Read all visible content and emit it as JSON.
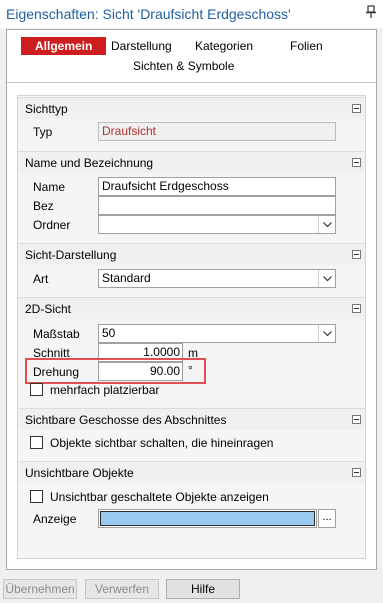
{
  "window": {
    "title": "Eigenschaften: Sicht 'Draufsicht Erdgeschoss'",
    "pin_icon": "pin-icon"
  },
  "tabs": [
    {
      "label": "Allgemein",
      "active": true
    },
    {
      "label": "Darstellung",
      "active": false
    },
    {
      "label": "Kategorien",
      "active": false
    },
    {
      "label": "Folien",
      "active": false
    },
    {
      "label": "Sichten & Symbole",
      "active": false
    }
  ],
  "sections": {
    "sichttyp": {
      "title": "Sichttyp",
      "typ_label": "Typ",
      "typ_value": "Draufsicht"
    },
    "name": {
      "title": "Name und Bezeichnung",
      "name_label": "Name",
      "name_value": "Draufsicht Erdgeschoss",
      "bez_label": "Bez",
      "bez_value": "",
      "ordner_label": "Ordner",
      "ordner_value": ""
    },
    "darstellung": {
      "title": "Sicht-Darstellung",
      "art_label": "Art",
      "art_value": "Standard"
    },
    "sicht2d": {
      "title": "2D-Sicht",
      "massstab_label": "Maßstab",
      "massstab_value": "50",
      "schnitt_label": "Schnitt",
      "schnitt_value": "1.0000",
      "schnitt_unit": "m",
      "drehung_label": "Drehung",
      "drehung_value": "90.00",
      "drehung_unit": "°",
      "mehrfach_label": "mehrfach platzierbar",
      "mehrfach_checked": false
    },
    "geschosse": {
      "title": "Sichtbare Geschosse des Abschnittes",
      "objekte_label": "Objekte sichtbar schalten, die hineinragen",
      "objekte_checked": false
    },
    "unsichtbar": {
      "title": "Unsichtbare Objekte",
      "anzeigen_label": "Unsichtbar geschaltete Objekte anzeigen",
      "anzeigen_checked": false,
      "anzeige_label": "Anzeige",
      "anzeige_color": "#9ac9f0",
      "dots": "..."
    }
  },
  "buttons": {
    "apply": "Übernehmen",
    "discard": "Verwerfen",
    "help": "Hilfe"
  },
  "colors": {
    "accent_tab": "#cc1e1e",
    "title": "#1f5f9f",
    "highlight": "#e05050",
    "readonly_text": "#b03030"
  }
}
